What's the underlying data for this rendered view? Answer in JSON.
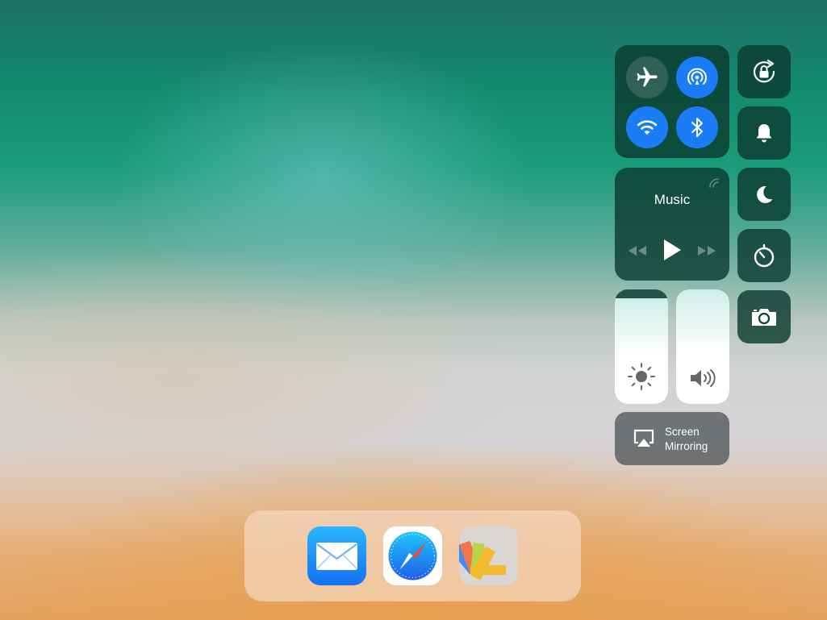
{
  "control_center": {
    "connectivity": [
      {
        "name": "airplane-mode",
        "icon": "airplane-icon",
        "state": "off"
      },
      {
        "name": "airdrop",
        "icon": "airdrop-icon",
        "state": "on"
      },
      {
        "name": "wifi",
        "icon": "wifi-icon",
        "state": "on"
      },
      {
        "name": "bluetooth",
        "icon": "bluetooth-icon",
        "state": "on"
      }
    ],
    "music": {
      "title": "Music",
      "controls": [
        "rewind-icon",
        "play-icon",
        "fast-forward-icon"
      ],
      "airplay_icon": "airplay-icon"
    },
    "toggles": [
      {
        "name": "rotation-lock",
        "icon": "rotation-lock-icon"
      },
      {
        "name": "mute",
        "icon": "bell-icon"
      },
      {
        "name": "do-not-disturb",
        "icon": "moon-icon"
      },
      {
        "name": "timer",
        "icon": "timer-icon"
      },
      {
        "name": "camera",
        "icon": "camera-icon"
      }
    ],
    "brightness": {
      "icon": "sun-icon",
      "level": 0.92
    },
    "volume": {
      "icon": "speaker-icon",
      "level": 1.0
    },
    "screen_mirroring": {
      "line1": "Screen",
      "line2": "Mirroring",
      "icon": "airplay-icon"
    }
  },
  "dock": {
    "apps": [
      {
        "name": "Mail",
        "icon": "mail-icon"
      },
      {
        "name": "Safari",
        "icon": "safari-icon"
      },
      {
        "name": "Fan App",
        "icon": "color-swatch-icon"
      }
    ]
  },
  "colors": {
    "toggle_on": "#1b7df5",
    "tile_background": "#0c3c30",
    "mail_gradient_top": "#27b6ff",
    "mail_gradient_bottom": "#1670f0"
  }
}
